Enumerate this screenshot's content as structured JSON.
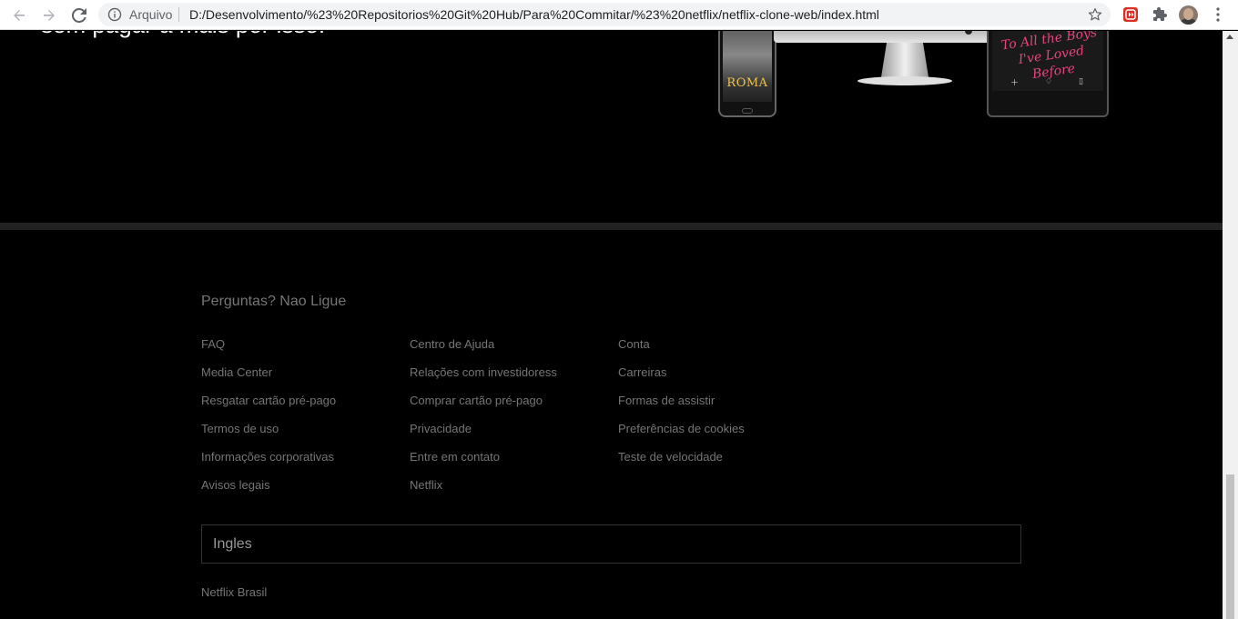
{
  "browser": {
    "origin_label": "Arquivo",
    "url": "D:/Desenvolvimento/%23%20Repositorios%20Git%20Hub/Para%20Commitar/%23%20netflix/netflix-clone-web/index.html",
    "icons": [
      "back-arrow-icon",
      "forward-arrow-icon",
      "reload-icon",
      "info-icon",
      "star-icon",
      "media-extension-icon",
      "puzzle-extension-icon",
      "avatar",
      "kebab-menu-icon"
    ],
    "accent_color": "#d93025"
  },
  "hero": {
    "text": "sem pagar a mais por isso.",
    "phone_title": "ROMA",
    "tablet_title": "To All the Boys I've Loved Before"
  },
  "footer": {
    "question": "Perguntas? Nao Ligue",
    "columns": [
      [
        "FAQ",
        "Media Center",
        "Resgatar cartão pré-pago",
        "Termos de uso",
        "Informações corporativas",
        "Avisos legais"
      ],
      [
        "Centro de Ajuda",
        "Relações com investidoress",
        "Comprar cartão pré-pago",
        "Privacidade",
        "Entre em contato",
        "Netflix"
      ],
      [
        "Conta",
        "Carreiras",
        "Formas de assistir",
        "Preferências de cookies",
        "Teste de velocidade"
      ]
    ],
    "language": "Ingles",
    "country": "Netflix Brasil"
  }
}
